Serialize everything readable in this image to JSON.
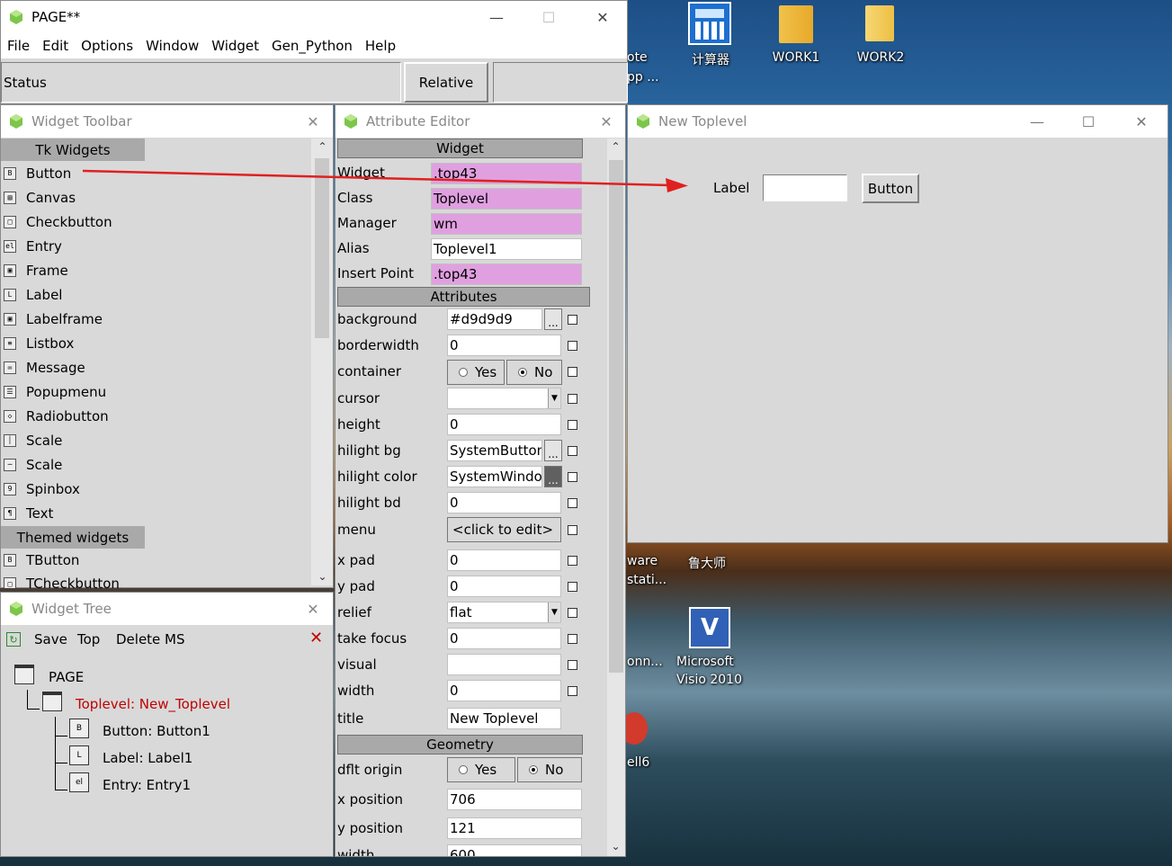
{
  "main_window": {
    "title": "PAGE**",
    "menu": [
      "File",
      "Edit",
      "Options",
      "Window",
      "Widget",
      "Gen_Python",
      "Help"
    ],
    "status_label": "Status",
    "relative_label": "Relative"
  },
  "widget_toolbar": {
    "title": "Widget Toolbar",
    "group_tk": "Tk Widgets",
    "items": [
      "Button",
      "Canvas",
      "Checkbutton",
      "Entry",
      "Frame",
      "Label",
      "Labelframe",
      "Listbox",
      "Message",
      "Popupmenu",
      "Radiobutton",
      "Scale",
      "Scale",
      "Spinbox",
      "Text"
    ],
    "group_themed": "Themed widgets",
    "themed_items": [
      "TButton",
      "TCheckbutton"
    ]
  },
  "widget_tree": {
    "title": "Widget Tree",
    "save": "Save",
    "top": "Top",
    "delete_ms": "Delete MS",
    "nodes": {
      "page": "PAGE",
      "toplevel": "Toplevel: New_Toplevel",
      "button": "Button: Button1",
      "label": "Label: Label1",
      "entry": "Entry: Entry1"
    }
  },
  "attribute_editor": {
    "title": "Attribute Editor",
    "section_widget": "Widget",
    "widget_rows": [
      {
        "label": "Widget",
        "value": ".top43"
      },
      {
        "label": "Class",
        "value": "Toplevel"
      },
      {
        "label": "Manager",
        "value": "wm"
      },
      {
        "label": "Alias",
        "value": "Toplevel1"
      },
      {
        "label": "Insert Point",
        "value": ".top43"
      }
    ],
    "section_attributes": "Attributes",
    "attr_rows": [
      {
        "label": "background",
        "value": "#d9d9d9"
      },
      {
        "label": "borderwidth",
        "value": "0"
      },
      {
        "label": "container",
        "value": ""
      },
      {
        "label": "cursor",
        "value": ""
      },
      {
        "label": "height",
        "value": "0"
      },
      {
        "label": "hilight bg",
        "value": "SystemButtonF"
      },
      {
        "label": "hilight color",
        "value": "SystemWindow"
      },
      {
        "label": "hilight bd",
        "value": "0"
      },
      {
        "label": "menu",
        "value": "<click to edit>"
      },
      {
        "label": "x pad",
        "value": "0"
      },
      {
        "label": "y pad",
        "value": "0"
      },
      {
        "label": "relief",
        "value": "flat"
      },
      {
        "label": "take focus",
        "value": "0"
      },
      {
        "label": "visual",
        "value": ""
      },
      {
        "label": "width",
        "value": "0"
      },
      {
        "label": "title",
        "value": "New Toplevel"
      }
    ],
    "yes": "Yes",
    "no": "No",
    "section_geometry": "Geometry",
    "geo_rows": [
      {
        "label": "dflt origin",
        "value": ""
      },
      {
        "label": "x position",
        "value": "706"
      },
      {
        "label": "y position",
        "value": "121"
      },
      {
        "label": "width",
        "value": "600"
      }
    ],
    "ellipsis": "..."
  },
  "new_toplevel": {
    "title": "New Toplevel",
    "label": "Label",
    "entry_value": "",
    "button": "Button"
  },
  "desktop": {
    "icons": [
      "WORK1",
      "WORK2"
    ],
    "calc_label": "计算器",
    "partial_labels": [
      "ote",
      "pp ...",
      "ware",
      "stati...",
      "鲁大师",
      "onn...",
      "Microsoft",
      "Visio 2010",
      "ell6"
    ]
  },
  "colors": {
    "accent_pink": "#e0a0e0",
    "arrow": "#e02020",
    "selected_tree": "#c00000"
  }
}
